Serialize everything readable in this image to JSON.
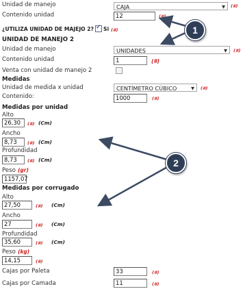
{
  "req_mark": "(#)",
  "row1": {
    "label": "Unidad de manejo",
    "value": "CAJA"
  },
  "row2": {
    "label": "Contenido unidad",
    "value": "12"
  },
  "row3": {
    "label": "¿UTILIZA UNIDAD DE MAJEJO 2?",
    "checkbox_label": "Si",
    "checked": true
  },
  "section_um2": "UNIDAD DE  MANEJO 2",
  "row4": {
    "label": "Unidad de manejo",
    "value": "UNIDADES"
  },
  "row5": {
    "label": "Contenido unidad",
    "value": "1",
    "req": "(#)"
  },
  "row6": {
    "label": "Venta con unidad de manejo 2",
    "checked": false
  },
  "section_medidas": "Medidas",
  "row7": {
    "label": "Unidad de medida x unidad",
    "value": "CENTÍMETRO CÚBICO"
  },
  "row8": {
    "label": "Contenido:",
    "value": "1000"
  },
  "medidas_unidad": {
    "title": "Medidas por unidad",
    "alto": {
      "label": "Alto",
      "value": "26,30",
      "unit": "(Cm)"
    },
    "ancho": {
      "label": "Ancho",
      "value": "8,73",
      "unit": "(Cm)"
    },
    "profundidad": {
      "label": "Profundidad",
      "value": "8,73",
      "unit": "(Cm)"
    },
    "peso": {
      "label": "Peso",
      "unit": "(gr)",
      "value": "1157,07"
    }
  },
  "medidas_corrugado": {
    "title": "Medidas por corrugado",
    "alto": {
      "label": "Alto",
      "value": "27,50",
      "unit": "(Cm)"
    },
    "ancho": {
      "label": "Ancho",
      "value": "27",
      "unit": "(Cm)"
    },
    "profundidad": {
      "label": "Profundidad",
      "value": "35,60",
      "unit": "(Cm)"
    },
    "peso": {
      "label": "Peso",
      "unit": "(kg)",
      "value": "14,15"
    }
  },
  "cajas_paleta": {
    "label": "Cajas por Paleta",
    "value": "33"
  },
  "cajas_camada": {
    "label": "Cajas por Camada",
    "value": "11"
  },
  "callouts": {
    "one": "1",
    "two": "2"
  },
  "colors": {
    "accent": "#2f3e57",
    "required": "#cc2222"
  }
}
